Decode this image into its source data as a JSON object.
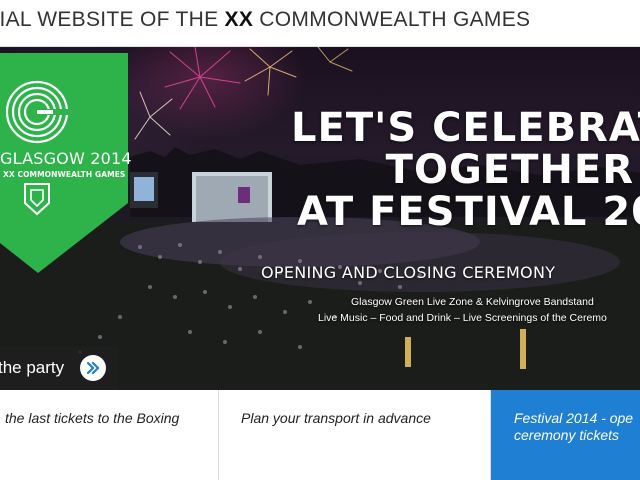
{
  "header": {
    "title_prefix": "CIAL WEBSITE OF THE ",
    "title_emphasis": "XX",
    "title_suffix": " COMMONWEALTH GAMES"
  },
  "logo": {
    "city": "GLASGOW 2014",
    "games": "XX COMMONWEALTH GAMES",
    "brand_green": "#2db34a"
  },
  "hero": {
    "headline": [
      "LET'S CELEBRAT",
      "TOGETHER",
      "AT FESTIVAL 20"
    ],
    "subheading": "OPENING AND CLOSING CEREMONY",
    "venues": "Glasgow Green Live Zone & Kelvingrove Bandstand",
    "extras": "Live Music – Food and Drink – Live Screenings of the Ceremo"
  },
  "cta": {
    "label": "the party",
    "icon": "double-chevron-right-icon"
  },
  "tiles": [
    {
      "text": "the last tickets to the Boxing"
    },
    {
      "text": "Plan your transport in advance"
    },
    {
      "line1": "Festival 2014 - ope",
      "line2": "ceremony tickets",
      "active_color": "#1f7fd2"
    }
  ]
}
